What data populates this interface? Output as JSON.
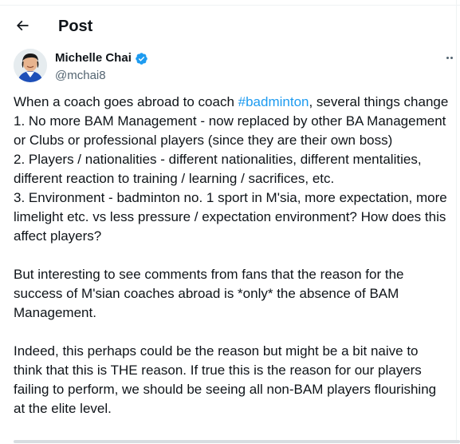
{
  "header": {
    "title": "Post",
    "back_icon": "arrow-left-icon"
  },
  "author": {
    "name": "Michelle Chai",
    "handle": "@mchai8",
    "verified_icon": "verified-badge-icon",
    "verified_color": "#1d9bf0",
    "more_icon": "more-horizontal-icon"
  },
  "tweet": {
    "p1_before": "When a coach goes abroad to coach ",
    "hashtag": "#badminton",
    "p1_after": ", several things change",
    "lines": [
      "1. No more BAM Management - now replaced by other BA Management",
      "or Clubs or professional players (since they are their own boss)",
      "2. Players / nationalities - different nationalities, different mentalities,",
      "different reaction to training / learning / sacrifices, etc.",
      "3. Environment - badminton no. 1 sport in M'sia, more expectation, more",
      "limelight etc. vs less pressure / expectation environment? How does this",
      "affect players?"
    ],
    "para2": [
      "But interesting to see comments from fans that the reason for the",
      "success of M'sian coaches abroad is *only* the absence of BAM",
      "Management."
    ],
    "para3": [
      "Indeed, this perhaps could be the reason but might be a bit naive to",
      "think that this is THE reason. If true this is the reason for our players",
      "failing to perform, we should be seeing all non-BAM players flourishing",
      "at the elite level."
    ]
  },
  "colors": {
    "text": "#0f1419",
    "secondary": "#536471",
    "accent": "#1d9bf0"
  }
}
